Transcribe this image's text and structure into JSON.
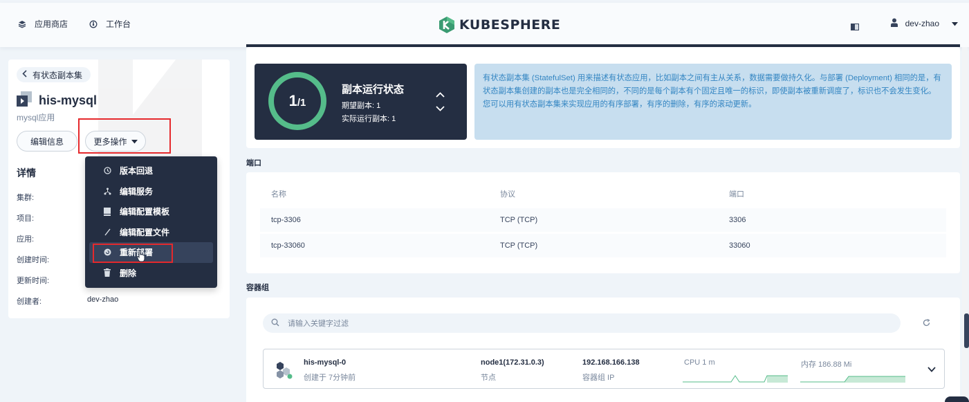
{
  "nav": {
    "app_store": "应用商店",
    "workbench": "工作台",
    "brand": "KUBESPHERE",
    "user": "dev-zhao"
  },
  "left": {
    "back_label": "有状态副本集",
    "title": "his-mysql",
    "subtitle": "mysql应用",
    "edit_info": "编辑信息",
    "more_actions": "更多操作",
    "details_title": "详情",
    "details": [
      {
        "label": "集群:",
        "value": ""
      },
      {
        "label": "项目:",
        "value": ""
      },
      {
        "label": "应用:",
        "value": ""
      },
      {
        "label": "创建时间:",
        "value": ""
      },
      {
        "label": "更新时间:",
        "value": ""
      },
      {
        "label": "创建者:",
        "value": "dev-zhao"
      }
    ]
  },
  "dropdown": {
    "items": [
      {
        "label": "版本回退",
        "icon": "history-icon"
      },
      {
        "label": "编辑服务",
        "icon": "network-icon"
      },
      {
        "label": "编辑配置模板",
        "icon": "template-icon"
      },
      {
        "label": "编辑配置文件",
        "icon": "pen-icon"
      },
      {
        "label": "重新部署",
        "icon": "redeploy-icon",
        "active": true
      },
      {
        "label": "删除",
        "icon": "trash-icon"
      }
    ]
  },
  "status": {
    "current": "1",
    "desired": "/1",
    "title": "副本运行状态",
    "desired_line": "期望副本: 1",
    "actual_line": "实际运行副本: 1",
    "ring_color": "#55bc8a"
  },
  "info_text": "有状态副本集 (StatefulSet) 用来描述有状态应用，比如副本之间有主从关系，数据需要做持久化。与部署 (Deployment) 相同的是，有状态副本集创建的副本也是完全相同的，不同的是每个副本有个固定且唯一的标识，即使副本被重新调度了，标识也不会发生变化。您可以用有状态副本集来实现应用的有序部署，有序的删除，有序的滚动更新。",
  "ports": {
    "section": "端口",
    "headers": [
      "名称",
      "协议",
      "端口"
    ],
    "rows": [
      [
        "tcp-3306",
        "TCP (TCP)",
        "3306"
      ],
      [
        "tcp-33060",
        "TCP (TCP)",
        "33060"
      ]
    ]
  },
  "pods": {
    "section": "容器组",
    "search_placeholder": "请输入关键字过滤",
    "items": [
      {
        "name": "his-mysql-0",
        "created": "创建于 7分钟前",
        "node": "node1(172.31.0.3)",
        "node_label": "节点",
        "ip": "192.168.166.138",
        "ip_label": "容器组 IP",
        "cpu": "CPU 1 m",
        "mem": "内存 186.88 Mi"
      }
    ]
  }
}
